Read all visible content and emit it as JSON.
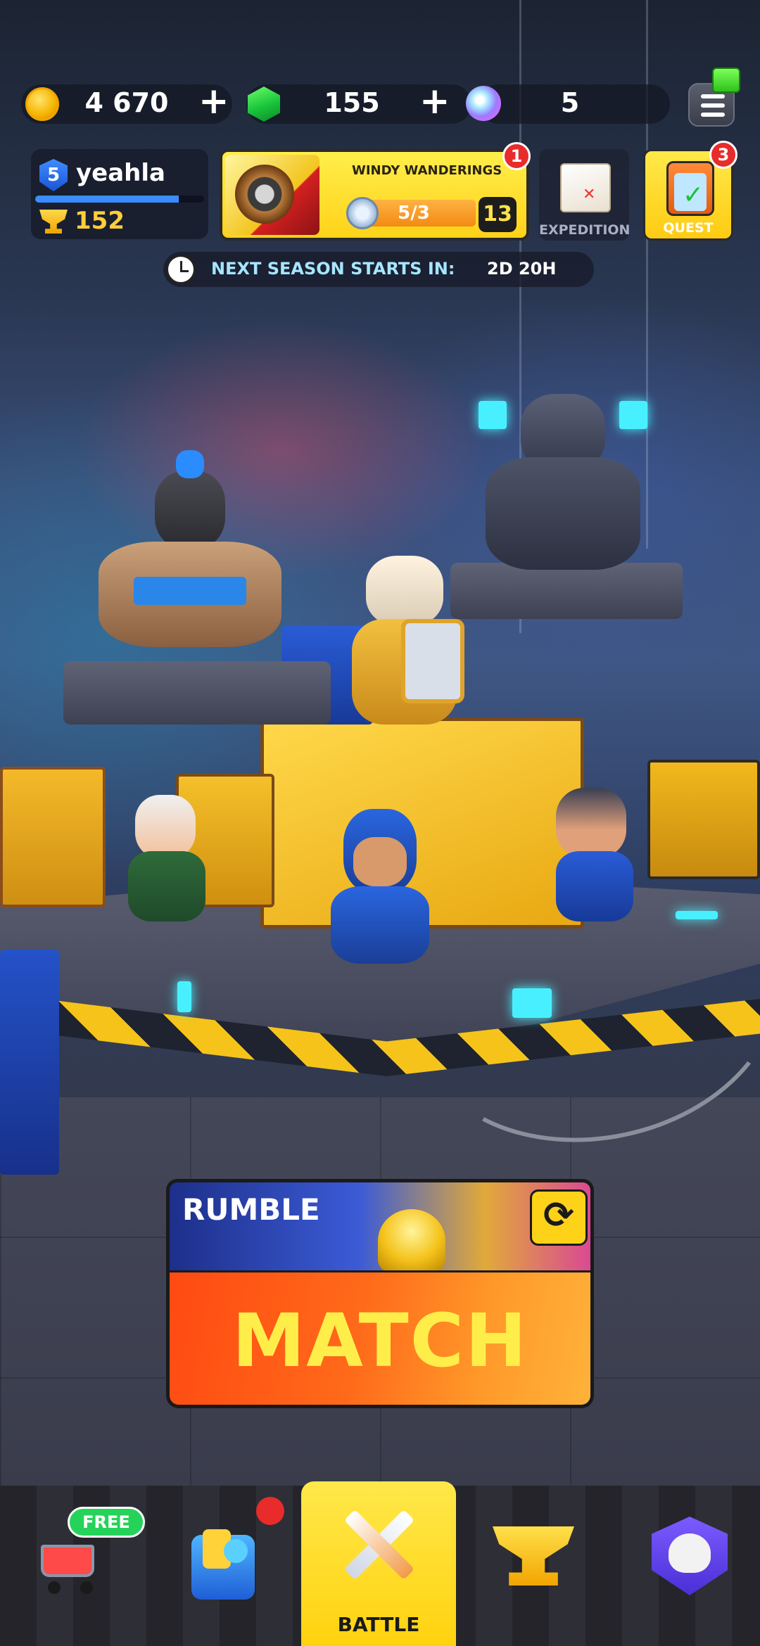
{
  "currencies": {
    "coins": "4 670",
    "gems": "155",
    "orbs": "5",
    "coin_plus": "+",
    "gem_plus": "+"
  },
  "profile": {
    "level": "5",
    "username": "yeahla",
    "trophies": "152",
    "xp_fraction": 0.85
  },
  "event": {
    "title": "WINDY WANDERINGS",
    "progress_text": "5/3",
    "level": "13",
    "notifications": "1"
  },
  "side_buttons": {
    "expedition_label": "EXPEDITION",
    "quest_label": "QUEST",
    "quest_notifications": "3"
  },
  "season": {
    "label": "NEXT SEASON STARTS IN:",
    "value": "2D 20H"
  },
  "battle": {
    "mode_label": "RUMBLE",
    "swap_icon": "⟳",
    "match_label": "MATCH"
  },
  "nav": {
    "free_badge": "FREE",
    "battle_label": "BATTLE"
  },
  "colors": {
    "accent_yellow": "#ffd21a",
    "match_orange": "#ff5a16",
    "match_text": "#ffee4a",
    "trophy_gold": "#ffce3a",
    "gem_green": "#19c43a",
    "badge_red": "#e82b2b"
  },
  "icons": [
    "coin-icon",
    "gem-icon",
    "orb-icon",
    "menu-icon",
    "gift-icon",
    "level-shield-icon",
    "trophy-icon",
    "token-icon",
    "map-icon",
    "clipboard-icon",
    "clock-icon",
    "swap-icon",
    "cart-icon",
    "deck-icon",
    "swords-icon",
    "cup-icon",
    "skull-icon"
  ]
}
